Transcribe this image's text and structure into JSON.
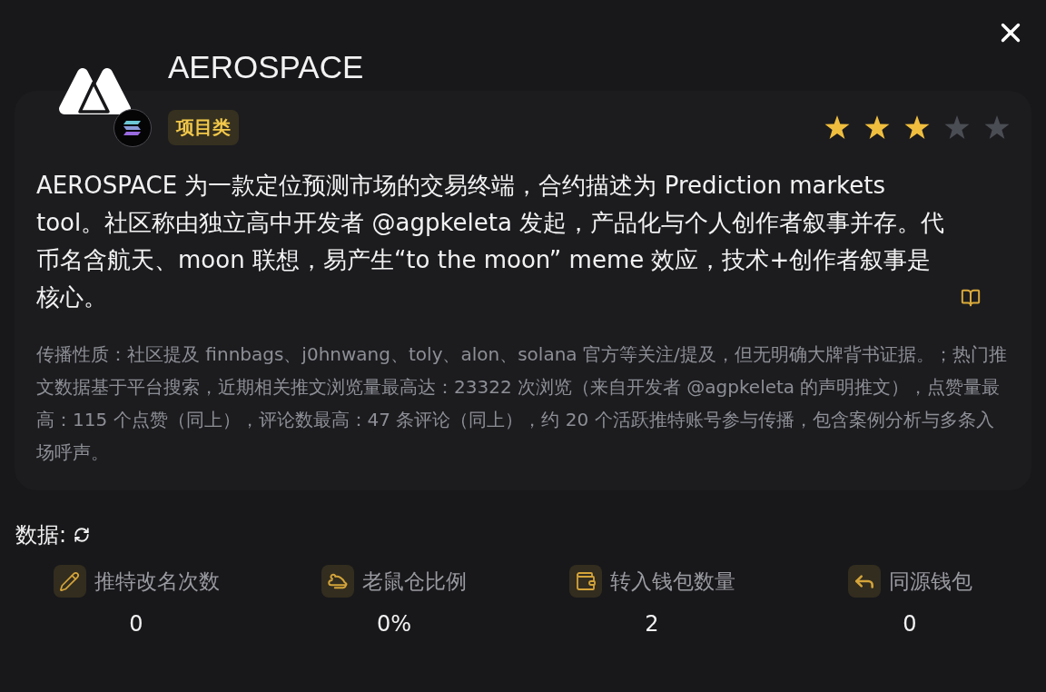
{
  "token": {
    "name": "AEROSPACE",
    "category_tag": "项目类",
    "stars": 3
  },
  "description": "AEROSPACE 为一款定位预测市场的交易终端，合约描述为 Prediction markets tool。社区称由独立高中开发者 @agpkeleta 发起，产品化与个人创作者叙事并存。代币名含航天、moon 联想，易产生“to the moon” meme 效应，技术+创作者叙事是核心。",
  "spread_note": "传播性质：社区提及 finnbags、j0hnwang、toly、alon、solana 官方等关注/提及，但无明确大牌背书证据。；热门推文数据基于平台搜索，近期相关推文浏览量最高达：23322 次浏览（来自开发者 @agpkeleta 的声明推文），点赞量最高：115 个点赞（同上），评论数最高：47 条评论（同上），约 20 个活跃推特账号参与传播，包含案例分析与多条入场呼声。",
  "data_section": {
    "title": "数据:",
    "stats": [
      {
        "kind": "rename",
        "label": "推特改名次数",
        "value": "0"
      },
      {
        "kind": "rat",
        "label": "老鼠仓比例",
        "value": "0%"
      },
      {
        "kind": "wallet",
        "label": "转入钱包数量",
        "value": "2"
      },
      {
        "kind": "same-source",
        "label": "同源钱包",
        "value": "0"
      }
    ]
  }
}
